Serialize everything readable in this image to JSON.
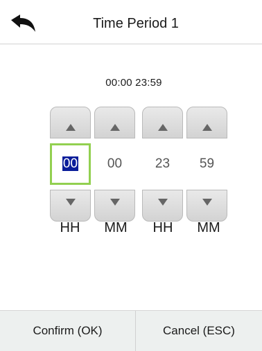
{
  "header": {
    "title": "Time Period 1",
    "back_icon": "back-arrow-icon"
  },
  "time_range": {
    "text": "00:00  23:59",
    "start": "00:00",
    "end": "23:59"
  },
  "spinners": [
    {
      "value": "00",
      "unit": "HH",
      "focused": true
    },
    {
      "value": "00",
      "unit": "MM",
      "focused": false
    },
    {
      "value": "23",
      "unit": "HH",
      "focused": false
    },
    {
      "value": "59",
      "unit": "MM",
      "focused": false
    }
  ],
  "icons": {
    "up": "triangle-up-icon",
    "down": "triangle-down-icon"
  },
  "colors": {
    "focus_border": "#92d050",
    "selection_bg": "#0a1d9a",
    "footer_bg": "#edf0ef"
  },
  "footer": {
    "confirm_label": "Confirm (OK)",
    "cancel_label": "Cancel (ESC)"
  }
}
